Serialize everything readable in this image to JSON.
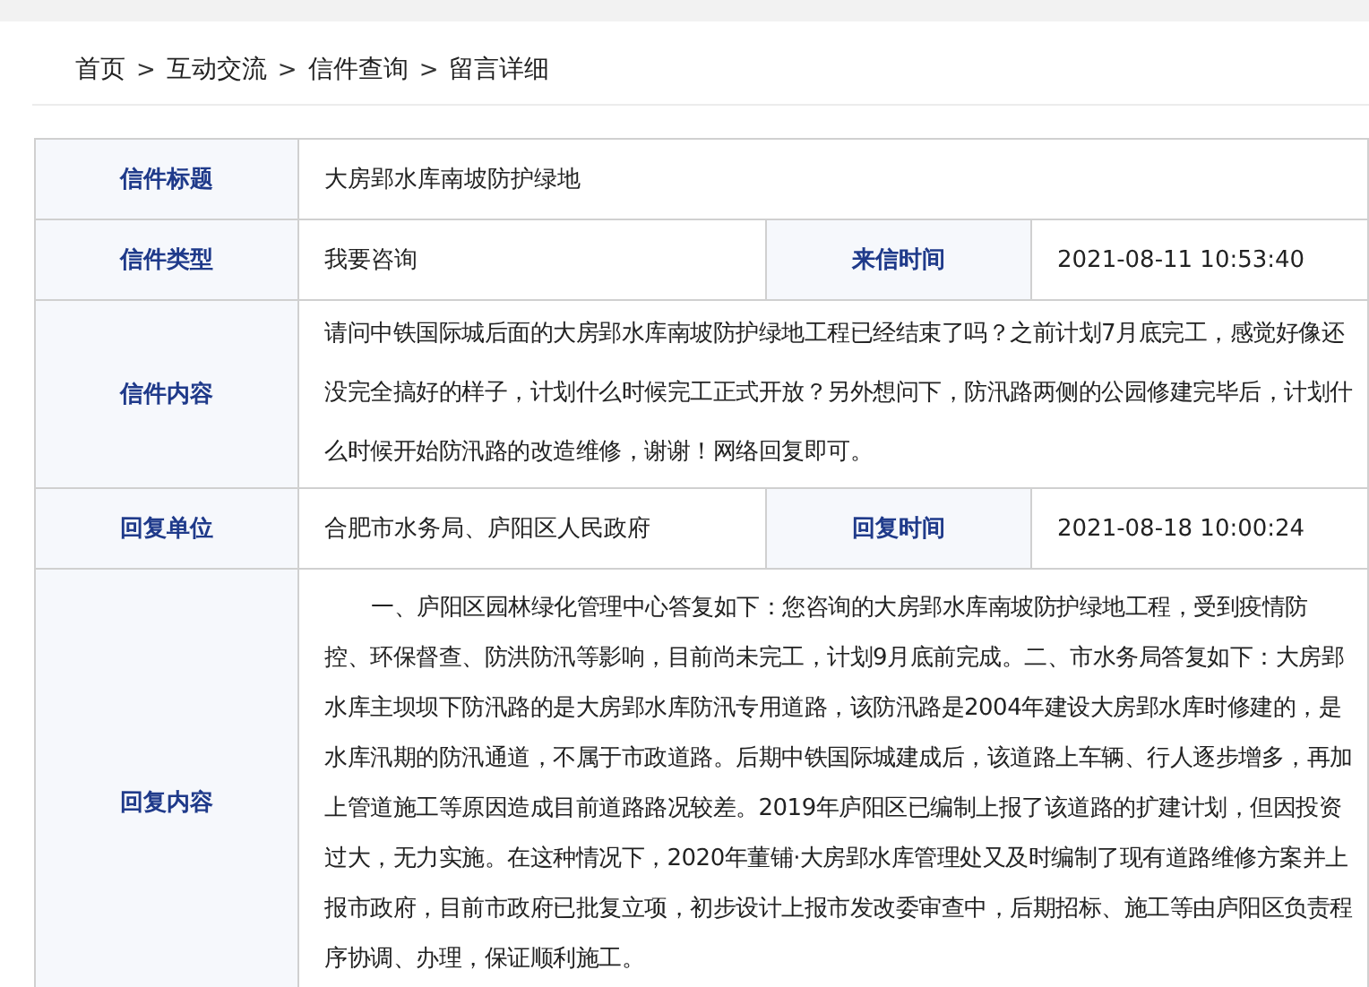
{
  "breadcrumb": {
    "separator": ">",
    "items": [
      "首页",
      "互动交流",
      "信件查询",
      "留言详细"
    ]
  },
  "table": {
    "rows": [
      {
        "kind": "line",
        "fields": [
          {
            "label": "信件标题",
            "value": "大房郢水库南坡防护绿地"
          }
        ]
      },
      {
        "kind": "line",
        "fields": [
          {
            "label": "信件类型",
            "value": "我要咨询"
          },
          {
            "label": "来信时间",
            "value": "2021-08-11 10:53:40"
          }
        ]
      },
      {
        "kind": "text",
        "fields": [
          {
            "label": "信件内容",
            "value": "请问中铁国际城后面的大房郢水库南坡防护绿地工程已经结束了吗？之前计划7月底完工，感觉好像还没完全搞好的样子，计划什么时候完工正式开放？另外想问下，防汛路两侧的公园修建完毕后，计划什么时候开始防汛路的改造维修，谢谢！网络回复即可。"
          }
        ]
      },
      {
        "kind": "line",
        "fields": [
          {
            "label": "回复单位",
            "value": "合肥市水务局、庐阳区人民政府"
          },
          {
            "label": "回复时间",
            "value": "2021-08-18 10:00:24"
          }
        ]
      },
      {
        "kind": "indented",
        "fields": [
          {
            "label": "回复内容",
            "value": "一、庐阳区园林绿化管理中心答复如下：您咨询的大房郢水库南坡防护绿地工程，受到疫情防控、环保督查、防洪防汛等影响，目前尚未完工，计划9月底前完成。二、市水务局答复如下：大房郢水库主坝坝下防汛路的是大房郢水库防汛专用道路，该防汛路是2004年建设大房郢水库时修建的，是水库汛期的防汛通道，不属于市政道路。后期中铁国际城建成后，该道路上车辆、行人逐步增多，再加上管道施工等原因造成目前道路路况较差。2019年庐阳区已编制上报了该道路的扩建计划，但因投资过大，无力实施。在这种情况下，2020年董铺·大房郢水库管理处又及时编制了现有道路维修方案并上报市政府，目前市政府已批复立项，初步设计上报市发改委审查中，后期招标、施工等由庐阳区负责程序协调、办理，保证顺利施工。"
          }
        ]
      }
    ]
  }
}
